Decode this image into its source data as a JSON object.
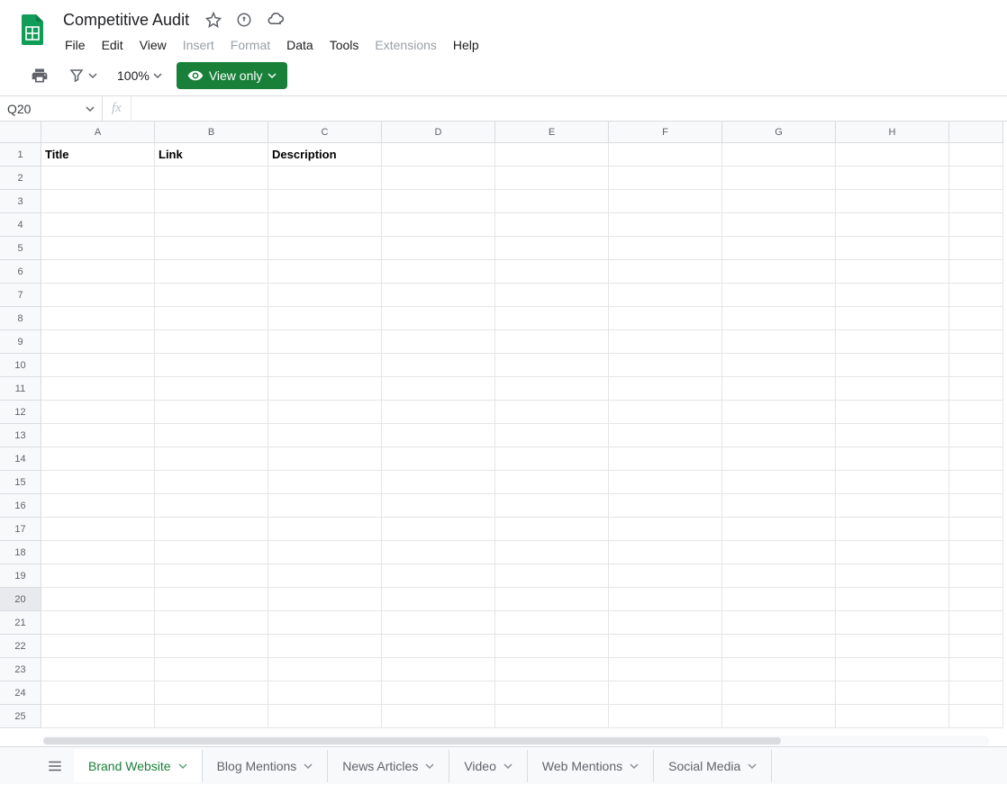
{
  "doc": {
    "title": "Competitive Audit"
  },
  "menu": {
    "file": "File",
    "edit": "Edit",
    "view": "View",
    "insert": "Insert",
    "format": "Format",
    "data": "Data",
    "tools": "Tools",
    "extensions": "Extensions",
    "help": "Help"
  },
  "toolbar": {
    "zoom": "100%",
    "view_only": "View only"
  },
  "formula": {
    "cell_ref": "Q20",
    "fx": "fx"
  },
  "grid": {
    "columns": [
      "A",
      "B",
      "C",
      "D",
      "E",
      "F",
      "G",
      "H",
      ""
    ],
    "row_count": 25,
    "selected_row": 20,
    "headers": {
      "A": "Title",
      "B": "Link",
      "C": "Description"
    }
  },
  "tabs": {
    "items": [
      {
        "label": "Brand Website",
        "active": true
      },
      {
        "label": "Blog Mentions",
        "active": false
      },
      {
        "label": "News Articles",
        "active": false
      },
      {
        "label": "Video",
        "active": false
      },
      {
        "label": "Web Mentions",
        "active": false
      },
      {
        "label": "Social Media",
        "active": false
      }
    ]
  }
}
